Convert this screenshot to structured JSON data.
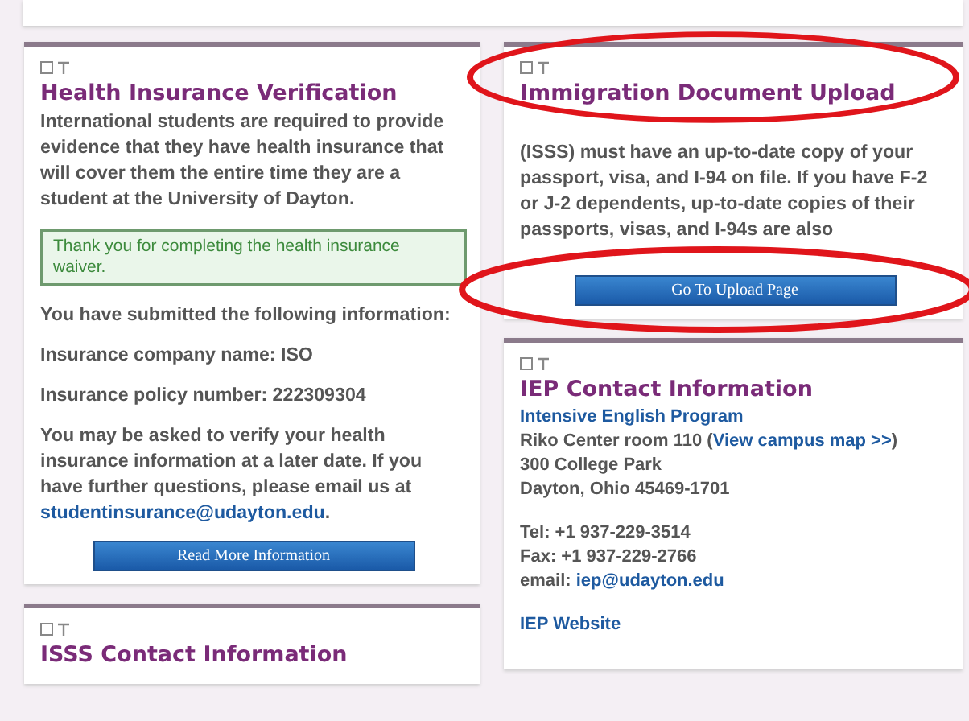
{
  "columns": [
    {
      "cards": [
        {
          "title": "Health Insurance Verification",
          "circled": false,
          "blocks": [
            {
              "kind": "paragraph",
              "parts": [
                {
                  "kind": "text",
                  "text": "International students are required to provide evidence that they have health insurance that will cover them the entire time they are a student at the University of Dayton."
                }
              ]
            },
            {
              "kind": "notice",
              "text": "Thank you for completing the health insurance waiver."
            },
            {
              "kind": "paragraph",
              "parts": [
                {
                  "kind": "text",
                  "text": "You have submitted the following information:"
                }
              ]
            },
            {
              "kind": "paragraph",
              "parts": [
                {
                  "kind": "text",
                  "text": "Insurance company name: ISO"
                }
              ]
            },
            {
              "kind": "paragraph",
              "parts": [
                {
                  "kind": "text",
                  "text": "Insurance policy number: 222309304"
                }
              ]
            },
            {
              "kind": "paragraph",
              "parts": [
                {
                  "kind": "text",
                  "text": "You may be asked to verify your health insurance information at a later date. If you have further questions, please email us at "
                },
                {
                  "kind": "link",
                  "text": "studentinsurance@udayton.edu"
                },
                {
                  "kind": "text",
                  "text": "."
                }
              ]
            },
            {
              "kind": "button",
              "label": "Read More Information",
              "circled": false
            }
          ]
        },
        {
          "title": "ISSS Contact Information",
          "circled": false
        }
      ]
    },
    {
      "cards": [
        {
          "title": "Immigration Document Upload",
          "circled": true,
          "blocks": [
            {
              "kind": "covered_paragraph",
              "parts": [
                {
                  "kind": "text",
                  "text": "(ISSS) must have an up-to-date copy of your passport, visa, and I-94 on file. If you have F-2 or J-2 dependents, up-to-date copies of their passports, visas, and I-94s are also"
                }
              ]
            },
            {
              "kind": "button",
              "label": "Go To Upload Page",
              "circled": true
            }
          ]
        },
        {
          "title": "IEP Contact Information",
          "circled": false,
          "blocks": [
            {
              "kind": "lines",
              "lines": [
                [
                  {
                    "kind": "link",
                    "text": "Intensive English Program"
                  }
                ],
                [
                  {
                    "kind": "text",
                    "text": "Riko Center room 110 ("
                  },
                  {
                    "kind": "link",
                    "text": "View campus map >>"
                  },
                  {
                    "kind": "text",
                    "text": ")"
                  }
                ],
                [
                  {
                    "kind": "text",
                    "text": "300 College Park"
                  }
                ],
                [
                  {
                    "kind": "text",
                    "text": "Dayton, Ohio 45469-1701"
                  }
                ]
              ]
            },
            {
              "kind": "lines",
              "lines": [
                [
                  {
                    "kind": "text",
                    "text": "Tel: +1 937-229-3514"
                  }
                ],
                [
                  {
                    "kind": "text",
                    "text": "Fax: +1 937-229-2766"
                  }
                ],
                [
                  {
                    "kind": "text",
                    "text": "email: "
                  },
                  {
                    "kind": "link",
                    "text": "iep@udayton.edu"
                  }
                ]
              ]
            },
            {
              "kind": "lines",
              "lines": [
                [
                  {
                    "kind": "link",
                    "text": "IEP Website"
                  }
                ]
              ]
            }
          ]
        }
      ]
    }
  ]
}
